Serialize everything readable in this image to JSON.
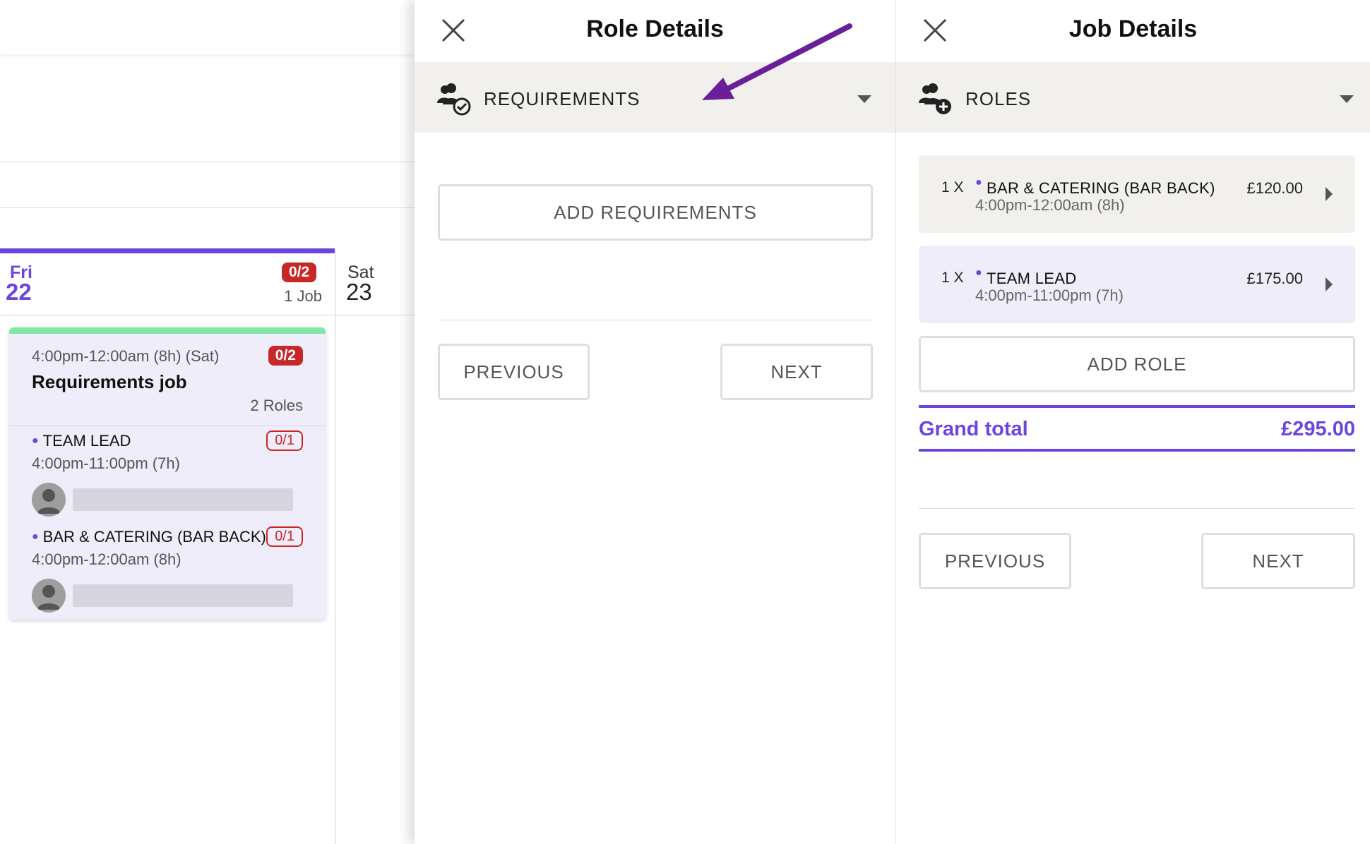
{
  "calendar": {
    "friday": {
      "day": "Fri",
      "date": "22",
      "badge": "0/2",
      "jobs": "1 Job"
    },
    "saturday": {
      "day": "Sat",
      "date": "23"
    },
    "job_card": {
      "time": "4:00pm-12:00am (8h) (Sat)",
      "badge": "0/2",
      "title": "Requirements job",
      "roles_count": "2 Roles",
      "roles": [
        {
          "name": "TEAM LEAD",
          "badge": "0/1",
          "time": "4:00pm-11:00pm (7h)"
        },
        {
          "name": "BAR & CATERING (BAR BACK)",
          "badge": "0/1",
          "time": "4:00pm-12:00am (8h)"
        }
      ]
    }
  },
  "role_panel": {
    "title": "Role Details",
    "section_label": "REQUIREMENTS",
    "section_icon": "users-check-icon",
    "add_button": "ADD REQUIREMENTS",
    "previous_button": "PREVIOUS",
    "next_button": "NEXT"
  },
  "job_panel": {
    "title": "Job Details",
    "section_label": "ROLES",
    "section_icon": "users-add-icon",
    "roles": [
      {
        "qty": "1 X",
        "name": "BAR & CATERING (BAR BACK)",
        "time": "4:00pm-12:00am (8h)",
        "price": "£120.00",
        "bg": "#f2f0ec"
      },
      {
        "qty": "1 X",
        "name": "TEAM LEAD",
        "time": "4:00pm-11:00pm (7h)",
        "price": "£175.00",
        "bg": "#efedfa"
      }
    ],
    "add_role_button": "ADD ROLE",
    "grand_total_label": "Grand total",
    "grand_total_value": "£295.00",
    "previous_button": "PREVIOUS",
    "next_button": "NEXT"
  },
  "colors": {
    "accent": "#6c45e0",
    "danger": "#c62828",
    "job_accent": "#7fe6a6",
    "arrow": "#6a1f9a"
  }
}
